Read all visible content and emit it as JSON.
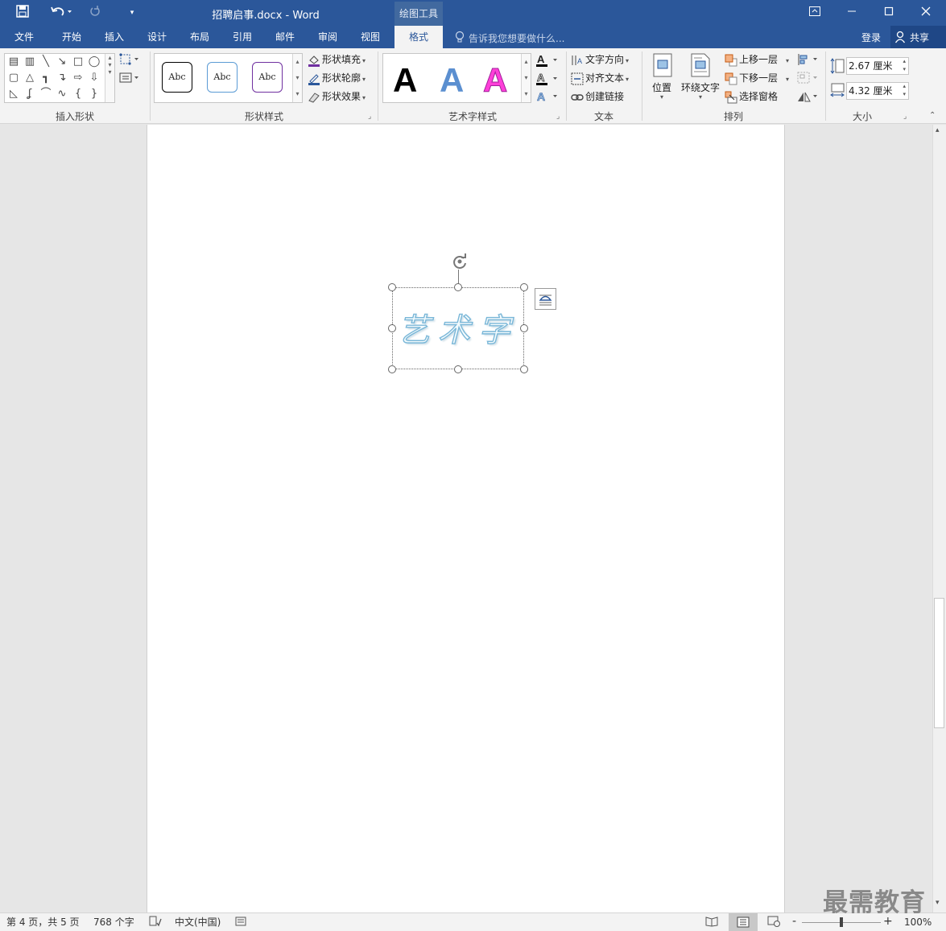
{
  "window": {
    "title": "招聘启事.docx - Word",
    "context_tab_group": "绘图工具",
    "controls": {
      "ribbon_display": "ribbon-display-icon",
      "minimize": "minimize-icon",
      "maximize": "maximize-icon",
      "close": "close-icon"
    }
  },
  "qat": {
    "save_icon": "save-icon",
    "undo_icon": "undo-icon",
    "redo_icon": "redo-icon",
    "customize_icon": "customize-qat-icon"
  },
  "tabs": [
    {
      "label": "文件"
    },
    {
      "label": "开始"
    },
    {
      "label": "插入"
    },
    {
      "label": "设计"
    },
    {
      "label": "布局"
    },
    {
      "label": "引用"
    },
    {
      "label": "邮件"
    },
    {
      "label": "审阅"
    },
    {
      "label": "视图"
    },
    {
      "label": "格式",
      "active": true
    }
  ],
  "tell_me": "告诉我您想要做什么...",
  "account": {
    "signin": "登录",
    "share": "共享"
  },
  "ribbon": {
    "insert_shapes": {
      "label": "插入形状"
    },
    "shape_styles": {
      "label": "形状样式",
      "preset_text": "Abc",
      "fill": "形状填充",
      "outline": "形状轮廓",
      "effects": "形状效果"
    },
    "wordart_styles": {
      "label": "艺术字样式",
      "letter": "A",
      "colors": [
        "#000000",
        "#5b8fd0",
        "#ff3fd9"
      ]
    },
    "text": {
      "label": "文本",
      "direction": "文字方向",
      "align": "对齐文本",
      "link": "创建链接"
    },
    "arrange": {
      "label": "排列",
      "position": "位置",
      "wrap": "环绕文字",
      "forward": "上移一层",
      "backward": "下移一层",
      "pane": "选择窗格"
    },
    "size": {
      "label": "大小",
      "height": "2.67 厘米",
      "width": "4.32 厘米"
    }
  },
  "document": {
    "wordart_text": "艺术字"
  },
  "status": {
    "page": "第 4 页，共 5 页",
    "words": "768 个字",
    "language": "中文(中国)",
    "zoom": "100%",
    "zoom_minus": "-",
    "zoom_plus": "+"
  },
  "watermark": "最需教育",
  "colors": {
    "word_blue": "#2b579a",
    "ribbon_bg": "#f3f3f3",
    "wordart_stroke": "#7ab7d8"
  }
}
